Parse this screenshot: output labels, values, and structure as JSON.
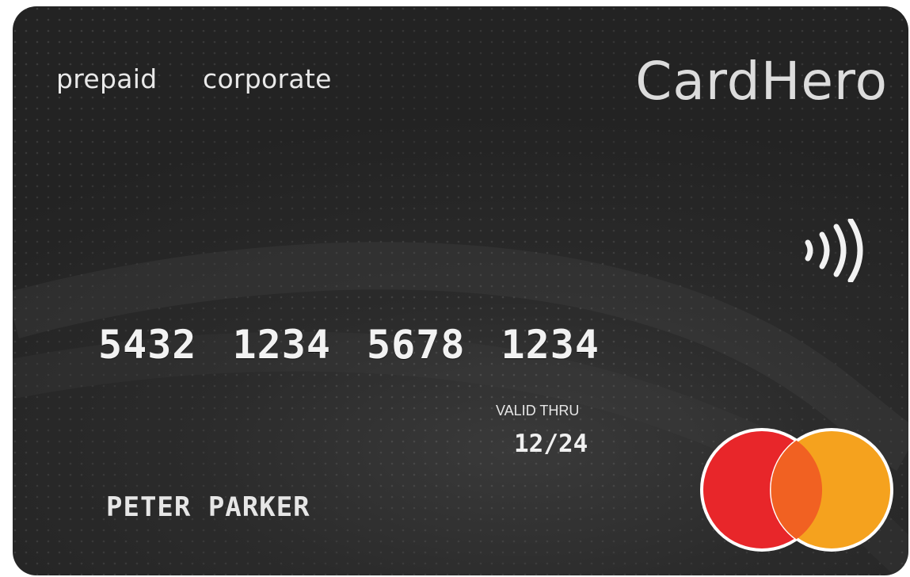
{
  "card": {
    "tag_prepaid": "prepaid",
    "tag_corporate": "corporate",
    "brand": "CardHero",
    "number": "5432 1234 5678 1234",
    "valid_thru_label": "VALID THRU",
    "expiry": "12/24",
    "holder_name": "PETER PARKER"
  },
  "icons": {
    "contactless": "contactless-icon",
    "network_logo": "mastercard-logo-icon"
  },
  "colors": {
    "card_bg": "#262626",
    "logo_red": "#e8262a",
    "logo_orange": "#f5a21e",
    "logo_overlap": "#f16122"
  }
}
